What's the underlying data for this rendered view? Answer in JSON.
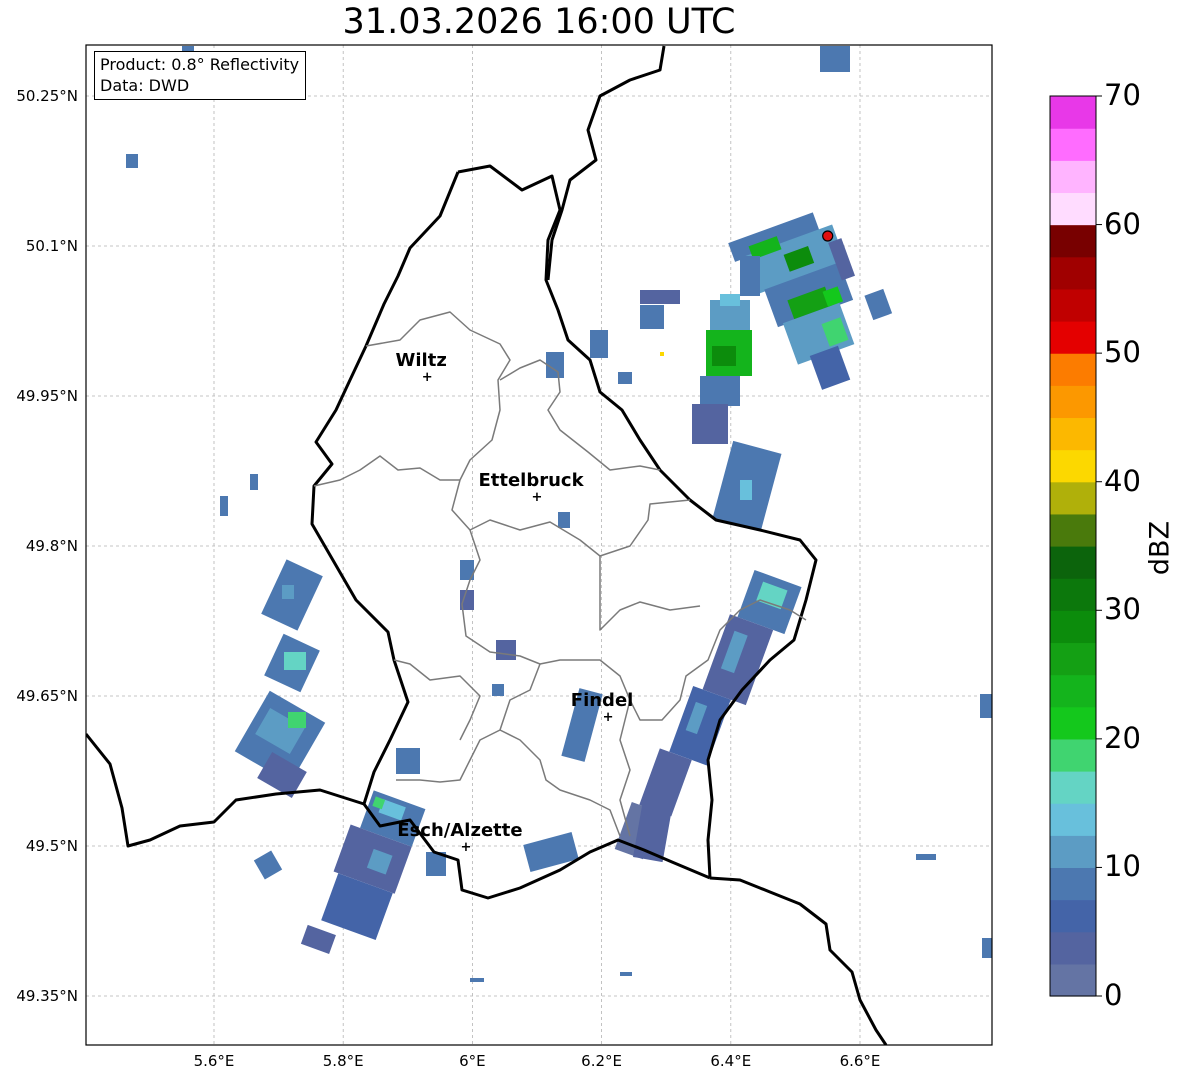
{
  "title": "31.03.2026 16:00 UTC",
  "infobox": {
    "product": "Product: 0.8° Reflectivity",
    "data": "Data: DWD"
  },
  "axes": {
    "lon_ticks": [
      "5.6°E",
      "5.8°E",
      "6°E",
      "6.2°E",
      "6.4°E",
      "6.6°E"
    ],
    "lat_ticks": [
      "50.25°N",
      "50.1°N",
      "49.95°N",
      "49.8°N",
      "49.65°N",
      "49.5°N",
      "49.35°N"
    ]
  },
  "cities": [
    {
      "name": "Wiltz",
      "lon": 5.93,
      "lat": 49.97
    },
    {
      "name": "Ettelbruck",
      "lon": 6.1,
      "lat": 49.85
    },
    {
      "name": "Findel",
      "lon": 6.21,
      "lat": 49.63
    },
    {
      "name": "Esch/Alzette",
      "lon": 5.99,
      "lat": 49.5
    }
  ],
  "radar_site": {
    "lon": 6.55,
    "lat": 50.11,
    "color": "#e01010"
  },
  "colorbar": {
    "label": "dBZ",
    "min": 0,
    "max": 70,
    "step": 2.5,
    "ticks": [
      "0",
      "10",
      "20",
      "30",
      "40",
      "50",
      "60",
      "70"
    ],
    "colors": [
      "#6474a4",
      "#5464a0",
      "#4464a8",
      "#4c78b0",
      "#5c9cc4",
      "#68c0dc",
      "#64d4c4",
      "#40d470",
      "#14c81c",
      "#14b41c",
      "#14a014",
      "#0c8c0c",
      "#0c780c",
      "#0c640c",
      "#4a7a0c",
      "#b0b00a",
      "#fcd800",
      "#fcb800",
      "#fc9800",
      "#fc7c00",
      "#e40000",
      "#c00000",
      "#a00000",
      "#780000",
      "#ffdcff",
      "#ffb4ff",
      "#ff6cff",
      "#e838e8"
    ]
  }
}
